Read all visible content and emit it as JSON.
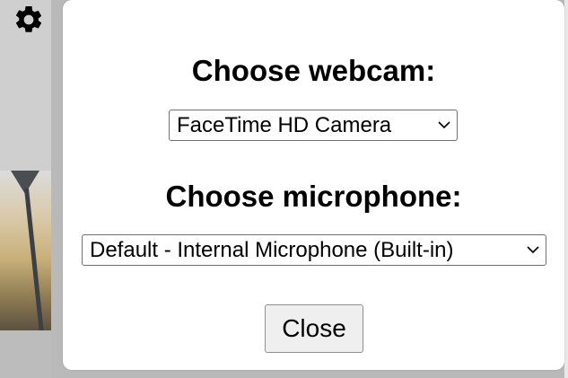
{
  "dialog": {
    "webcam_heading": "Choose webcam:",
    "webcam_selected": "FaceTime HD Camera",
    "microphone_heading": "Choose microphone:",
    "microphone_selected": "Default - Internal Microphone (Built-in)",
    "close_label": "Close"
  },
  "icons": {
    "settings": "gear-icon",
    "dropdown": "chevron-down-icon"
  },
  "colors": {
    "backdrop": "#b9b9b9",
    "modal_background": "#ffffff",
    "button_background": "#efefef"
  }
}
